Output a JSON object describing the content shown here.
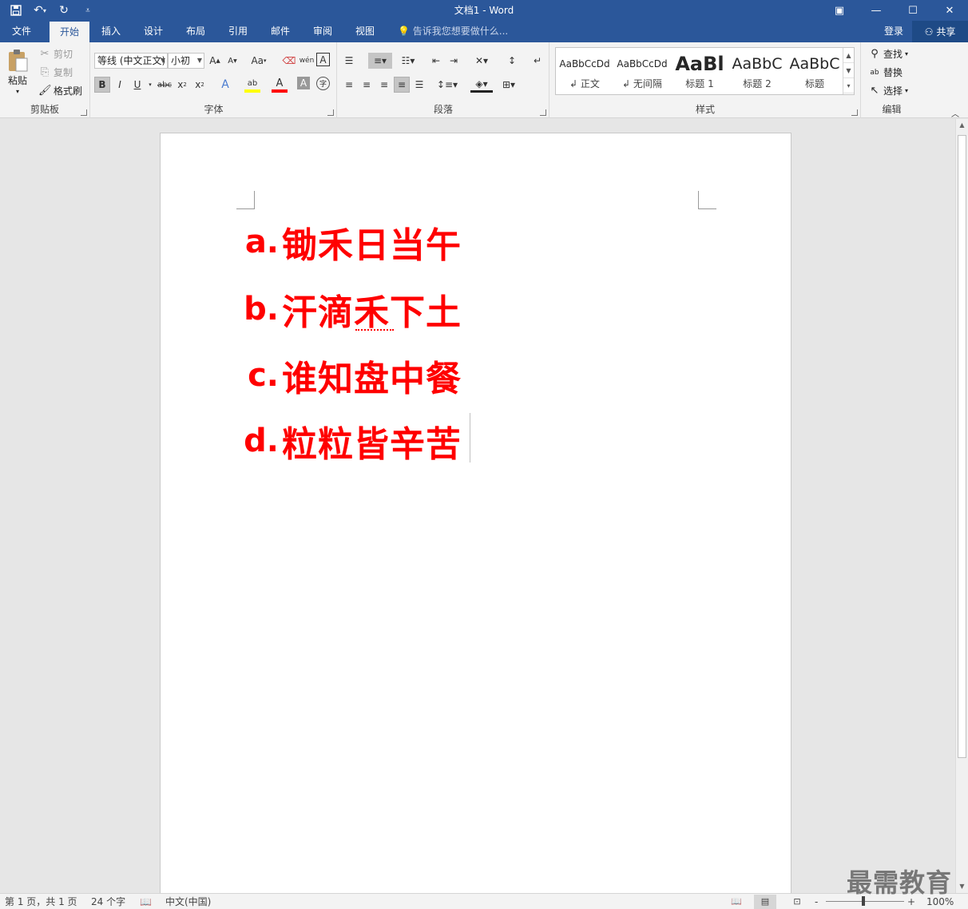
{
  "window": {
    "title": "文档1 - Word",
    "qat": {
      "save_icon": "save-icon",
      "undo_icon": "undo-icon",
      "redo_icon": "redo-icon",
      "customize_icon": "customize-qat-icon"
    }
  },
  "tabs": [
    "文件",
    "开始",
    "插入",
    "设计",
    "布局",
    "引用",
    "邮件",
    "审阅",
    "视图"
  ],
  "active_tab": "开始",
  "tell_me": "告诉我您想要做什么...",
  "sign_in": "登录",
  "share": "共享",
  "ribbon": {
    "clipboard": {
      "label": "剪贴板",
      "paste": "粘贴",
      "cut": "剪切",
      "copy": "复制",
      "format_painter": "格式刷"
    },
    "font": {
      "label": "字体",
      "font_name": "等线 (中文正文)",
      "font_size": "小初",
      "change_case": "Aa"
    },
    "paragraph": {
      "label": "段落"
    },
    "styles": {
      "label": "样式",
      "items": [
        {
          "sample": "AaBbCcDd",
          "name": "正文"
        },
        {
          "sample": "AaBbCcDd",
          "name": "无间隔"
        },
        {
          "sample": "AaBl",
          "name": "标题 1"
        },
        {
          "sample": "AaBbC",
          "name": "标题 2"
        },
        {
          "sample": "AaBbC",
          "name": "标题"
        }
      ]
    },
    "editing": {
      "label": "编辑",
      "find": "查找",
      "replace": "替换",
      "select": "选择"
    }
  },
  "document": {
    "lines": [
      {
        "marker": "a.",
        "text": "锄禾日当午"
      },
      {
        "marker": "b.",
        "text": "汗滴禾下土"
      },
      {
        "marker": "c.",
        "text": "谁知盘中餐"
      },
      {
        "marker": "d.",
        "text": "粒粒皆辛苦"
      }
    ],
    "text_color": "#ff0000"
  },
  "status": {
    "page": "第 1 页，共 1 页",
    "words": "24 个字",
    "language": "中文(中国)",
    "zoom": "100%",
    "zoom_minus": "-",
    "zoom_plus": "+"
  },
  "watermark": "最需教育",
  "colors": {
    "accent": "#2b579a",
    "ribbon_bg": "#f3f3f3",
    "doc_bg": "#e6e6e6"
  }
}
